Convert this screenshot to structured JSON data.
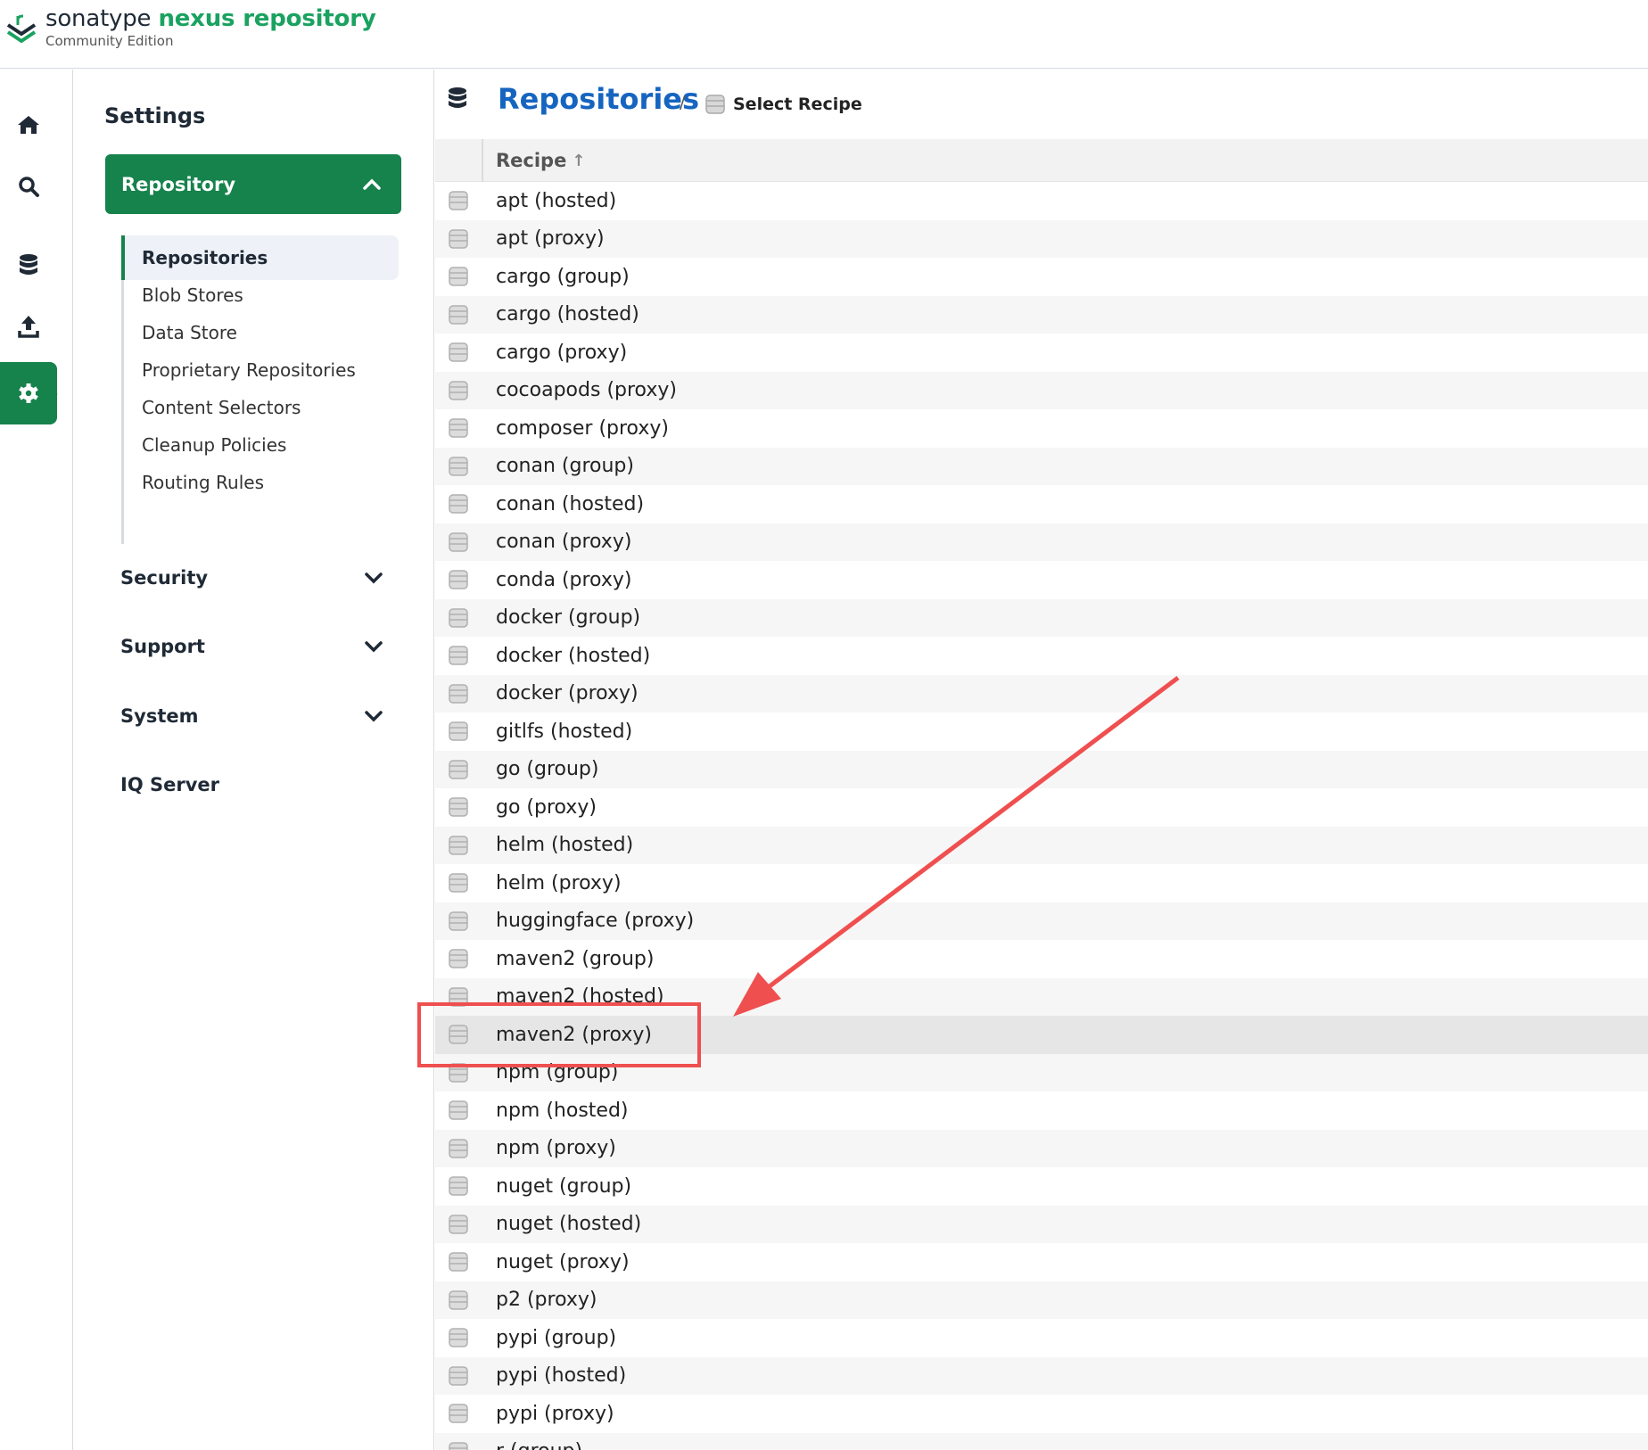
{
  "brand": {
    "name_part1": "sonatype",
    "name_part2": "nexus repository",
    "edition": "Community Edition"
  },
  "rail": {
    "items": [
      {
        "icon": "home-icon"
      },
      {
        "icon": "search-icon"
      },
      {
        "icon": "database-icon"
      },
      {
        "icon": "upload-icon"
      },
      {
        "icon": "gear-icon",
        "active": true
      }
    ]
  },
  "nav": {
    "title": "Settings",
    "active_group": "Repository",
    "sub_items": [
      "Repositories",
      "Blob Stores",
      "Data Store",
      "Proprietary Repositories",
      "Content Selectors",
      "Cleanup Policies",
      "Routing Rules"
    ],
    "groups": [
      "Security",
      "Support",
      "System",
      "IQ Server"
    ]
  },
  "breadcrumb": {
    "title": "Repositories",
    "separator": "/",
    "current": "Select Recipe"
  },
  "table": {
    "column": "Recipe",
    "sort": "ascending",
    "rows": [
      "apt (hosted)",
      "apt (proxy)",
      "cargo (group)",
      "cargo (hosted)",
      "cargo (proxy)",
      "cocoapods (proxy)",
      "composer (proxy)",
      "conan (group)",
      "conan (hosted)",
      "conan (proxy)",
      "conda (proxy)",
      "docker (group)",
      "docker (hosted)",
      "docker (proxy)",
      "gitlfs (hosted)",
      "go (group)",
      "go (proxy)",
      "helm (hosted)",
      "helm (proxy)",
      "huggingface (proxy)",
      "maven2 (group)",
      "maven2 (hosted)",
      "maven2 (proxy)",
      "npm (group)",
      "npm (hosted)",
      "npm (proxy)",
      "nuget (group)",
      "nuget (hosted)",
      "nuget (proxy)",
      "p2 (proxy)",
      "pypi (group)",
      "pypi (hosted)",
      "pypi (proxy)",
      "r (group)"
    ],
    "highlighted_row": "maven2 (proxy)"
  },
  "colors": {
    "brand_green": "#16824c",
    "link_blue": "#1565c0",
    "annotation_red": "#ef4f4f"
  }
}
